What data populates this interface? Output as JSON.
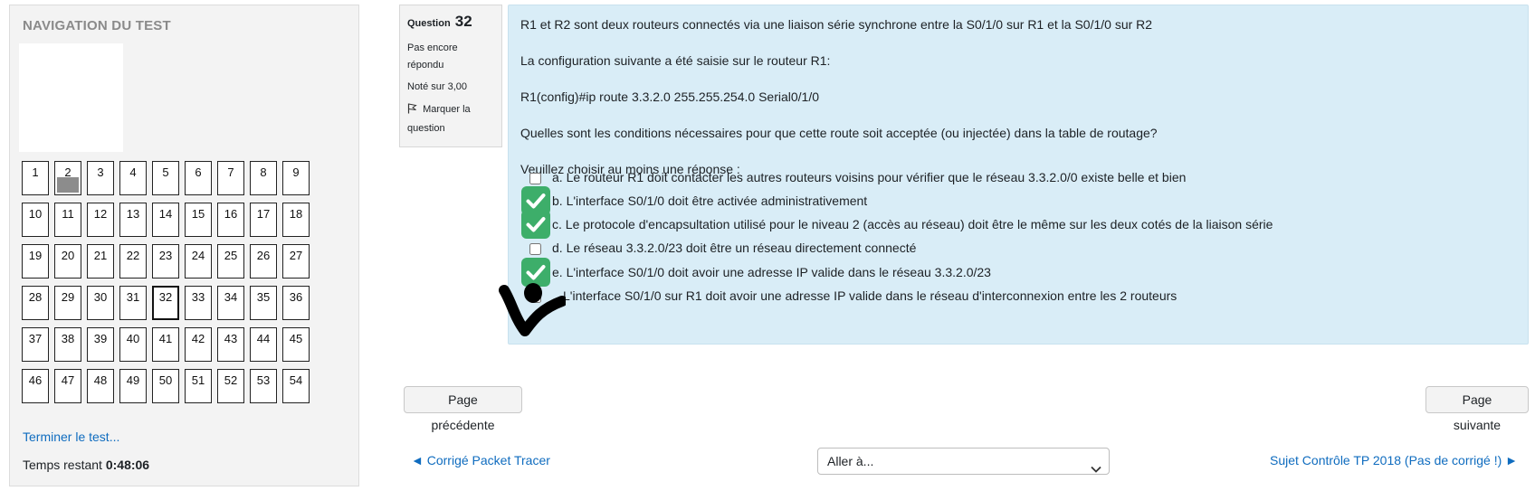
{
  "nav": {
    "title": "NAVIGATION DU TEST",
    "questions": [
      {
        "n": "1"
      },
      {
        "n": "2",
        "flagged": true
      },
      {
        "n": "3"
      },
      {
        "n": "4"
      },
      {
        "n": "5"
      },
      {
        "n": "6"
      },
      {
        "n": "7"
      },
      {
        "n": "8"
      },
      {
        "n": "9"
      },
      {
        "n": "10"
      },
      {
        "n": "11"
      },
      {
        "n": "12"
      },
      {
        "n": "13"
      },
      {
        "n": "14"
      },
      {
        "n": "15"
      },
      {
        "n": "16"
      },
      {
        "n": "17"
      },
      {
        "n": "18"
      },
      {
        "n": "19"
      },
      {
        "n": "20"
      },
      {
        "n": "21"
      },
      {
        "n": "22"
      },
      {
        "n": "23"
      },
      {
        "n": "24"
      },
      {
        "n": "25"
      },
      {
        "n": "26"
      },
      {
        "n": "27"
      },
      {
        "n": "28"
      },
      {
        "n": "29"
      },
      {
        "n": "30"
      },
      {
        "n": "31"
      },
      {
        "n": "32",
        "current": true
      },
      {
        "n": "33"
      },
      {
        "n": "34"
      },
      {
        "n": "35"
      },
      {
        "n": "36"
      },
      {
        "n": "37"
      },
      {
        "n": "38"
      },
      {
        "n": "39"
      },
      {
        "n": "40"
      },
      {
        "n": "41"
      },
      {
        "n": "42"
      },
      {
        "n": "43"
      },
      {
        "n": "44"
      },
      {
        "n": "45"
      },
      {
        "n": "46"
      },
      {
        "n": "47"
      },
      {
        "n": "48"
      },
      {
        "n": "49"
      },
      {
        "n": "50"
      },
      {
        "n": "51"
      },
      {
        "n": "52"
      },
      {
        "n": "53"
      },
      {
        "n": "54"
      }
    ],
    "finish_link": "Terminer le test...",
    "time_label": "Temps restant",
    "time_value": "0:48:06"
  },
  "question": {
    "label": "Question",
    "number": "32",
    "state": "Pas encore répondu",
    "grade": "Noté sur 3,00",
    "flag_label": "Marquer la question",
    "text": [
      "R1 et R2 sont deux routeurs connectés via une liaison série synchrone entre la S0/1/0 sur R1 et la S0/1/0 sur R2",
      "La configuration suivante a été saisie sur le routeur R1:",
      "R1(config)#ip route 3.3.2.0 255.255.254.0 Serial0/1/0",
      "Quelles sont les conditions nécessaires pour que cette route soit acceptée (ou injectée) dans la table de routage?"
    ],
    "prompt": "Veuillez choisir au moins une réponse :",
    "choices": [
      {
        "label": "a. Le routeur R1 doit contacter les autres routeurs voisins pour vérifier que le réseau 3.3.2.0/0 existe belle et bien",
        "checked": false
      },
      {
        "label": "b. L'interface S0/1/0 doit être activée administrativement",
        "checked": true
      },
      {
        "label": "c. Le protocole d'encapsultation utilisé pour le niveau 2 (accès au réseau) doit être le même sur les deux cotés de la liaison série",
        "checked": true
      },
      {
        "label": "d. Le réseau 3.3.2.0/23 doit être un réseau directement connecté",
        "checked": false
      },
      {
        "label": "e. L'interface S0/1/0 doit avoir une adresse IP valide dans le réseau 3.3.2.0/23",
        "checked": true
      },
      {
        "label": "L'interface S0/1/0 sur R1 doit avoir une adresse IP valide dans le réseau d'interconnexion entre les 2 routeurs",
        "checked": false
      }
    ]
  },
  "footer": {
    "prev_button": "Page précédente",
    "next_button": "Page suivante",
    "prev_activity": "◄ Corrigé Packet Tracer",
    "jump_placeholder": "Aller à...",
    "next_activity": "Sujet Contrôle TP 2018 (Pas de corrigé !) ►"
  },
  "colors": {
    "accent_link": "#0f6cbf",
    "question_bg": "#d9edf7",
    "check_badge": "#3dae6a"
  }
}
